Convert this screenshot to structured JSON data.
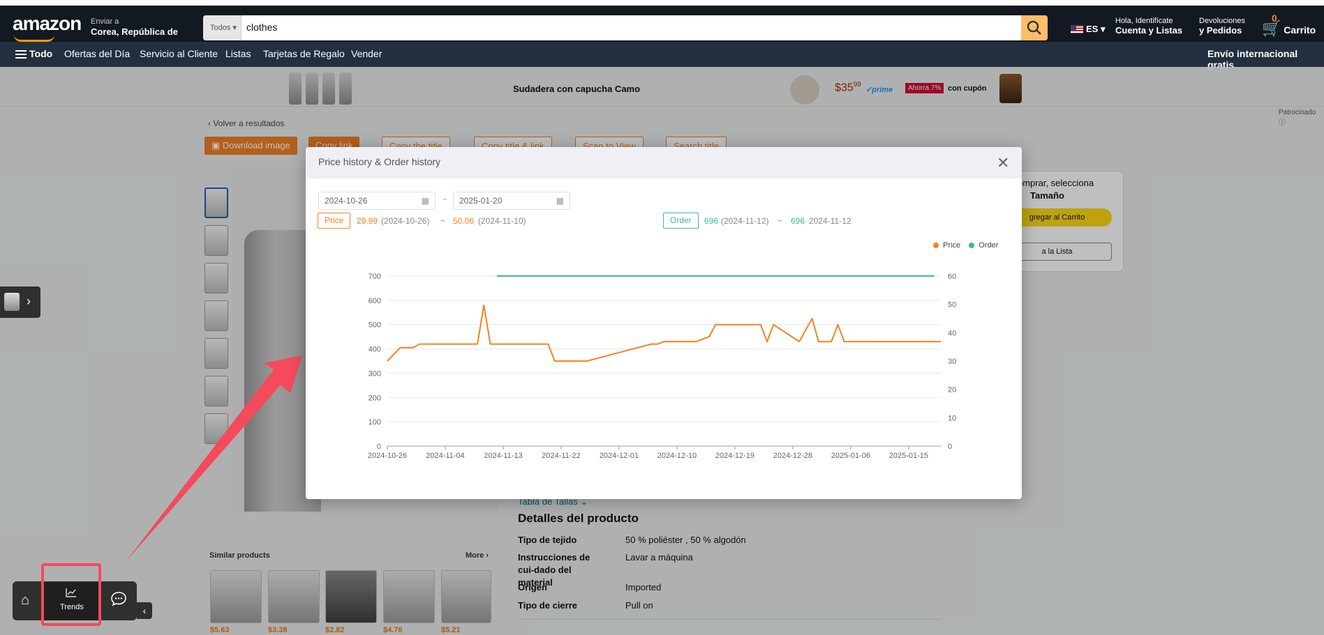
{
  "header": {
    "logo": "amazon",
    "deliver_label": "Enviar a",
    "deliver_location": "Corea, República de",
    "search_category": "Todos",
    "search_value": "clothes",
    "language": "ES",
    "account_greeting": "Hola, Identifícate",
    "account_lists": "Cuenta y Listas",
    "returns_line1": "Devoluciones",
    "returns_line2": "y Pedidos",
    "cart_count": "0",
    "cart_label": "Carrito"
  },
  "subnav": {
    "all": "Todo",
    "items": [
      "Ofertas del Día",
      "Servicio al Cliente",
      "Listas",
      "Tarjetas de Regalo",
      "Vender"
    ],
    "right": "Envío internacional gratis"
  },
  "ad": {
    "title": "Sudadera con capucha Camo",
    "price": "$35",
    "price_cents": "99",
    "prime": "prime",
    "save": "Ahorra 7%",
    "coupon": "con cupón",
    "sponsored": "Patrocinado"
  },
  "page": {
    "back": "‹ Volver a resultados",
    "tools": [
      "Download image",
      "Copy link",
      "Copy the title",
      "Copy title & link",
      "Scan to View",
      "Search title"
    ],
    "buybox_line1": "omprar, selecciona",
    "buybox_line2": "Tamaño",
    "add_to_cart": "gregar al Carrito",
    "add_to_list": "a la Lista",
    "size_chart": "Tabla de Tallas",
    "details_heading": "Detalles del producto",
    "details": [
      {
        "k": "Tipo de tejido",
        "v": "50 % poliéster , 50 % algodón"
      },
      {
        "k": "Instrucciones de cui-dado del material",
        "v": "Lavar a máquina"
      },
      {
        "k": "Origen",
        "v": "Imported"
      },
      {
        "k": "Tipo de cierre",
        "v": "Pull on"
      }
    ],
    "similar_heading": "Similar products",
    "similar_more": "More",
    "similar_prices": [
      "$5.63",
      "$3.38",
      "$2.82",
      "$4.76",
      "$5.21"
    ]
  },
  "toolbar": {
    "trends_label": "Trends"
  },
  "modal": {
    "title": "Price history & Order history",
    "date_from": "2024-10-26",
    "date_to": "2025-01-20",
    "price_pill": "Price",
    "price_low": "29.99",
    "price_low_date": "(2024-10-26)",
    "price_high": "50.06",
    "price_high_date": "(2024-11-10)",
    "order_pill": "Order",
    "order_low": "696",
    "order_low_date": "(2024-11-12)",
    "order_high": "696",
    "order_high_date": "2024-11-12",
    "range_sep": "~",
    "legend_price": "Price",
    "legend_order": "Order"
  },
  "colors": {
    "price_line": "#f58220",
    "order_line": "#3fb89a",
    "highlight": "#f44a5c"
  },
  "chart_data": {
    "type": "line",
    "x_ticks": [
      "2024-10-26",
      "2024-11-04",
      "2024-11-13",
      "2024-11-22",
      "2024-12-01",
      "2024-12-10",
      "2024-12-19",
      "2024-12-28",
      "2025-01-06",
      "2025-01-15"
    ],
    "y_left_ticks": [
      "0",
      "100",
      "200",
      "300",
      "400",
      "500",
      "600",
      "700"
    ],
    "y_right_ticks": [
      "0",
      "10",
      "20",
      "30",
      "40",
      "50",
      "60"
    ],
    "ylim_left": [
      0,
      700
    ],
    "ylim_right": [
      0,
      60
    ],
    "xlim": [
      "2024-10-26",
      "2025-01-20"
    ],
    "series": [
      {
        "name": "Price",
        "axis": "left",
        "points": [
          [
            "2024-10-26",
            350
          ],
          [
            "2024-10-28",
            405
          ],
          [
            "2024-10-30",
            405
          ],
          [
            "2024-10-31",
            420
          ],
          [
            "2024-11-09",
            420
          ],
          [
            "2024-11-10",
            580
          ],
          [
            "2024-11-11",
            420
          ],
          [
            "2024-11-20",
            420
          ],
          [
            "2024-11-21",
            350
          ],
          [
            "2024-11-26",
            350
          ],
          [
            "2024-12-06",
            420
          ],
          [
            "2024-12-07",
            420
          ],
          [
            "2024-12-08",
            430
          ],
          [
            "2024-12-13",
            430
          ],
          [
            "2024-12-15",
            450
          ],
          [
            "2024-12-16",
            500
          ],
          [
            "2024-12-23",
            500
          ],
          [
            "2024-12-24",
            430
          ],
          [
            "2024-12-25",
            500
          ],
          [
            "2024-12-29",
            430
          ],
          [
            "2024-12-31",
            525
          ],
          [
            "2025-01-01",
            430
          ],
          [
            "2025-01-03",
            430
          ],
          [
            "2025-01-04",
            500
          ],
          [
            "2025-01-05",
            430
          ],
          [
            "2025-01-20",
            430
          ]
        ]
      },
      {
        "name": "Order",
        "axis": "right",
        "points": [
          [
            "2024-11-12",
            60
          ],
          [
            "2025-01-19",
            60
          ]
        ]
      }
    ]
  }
}
